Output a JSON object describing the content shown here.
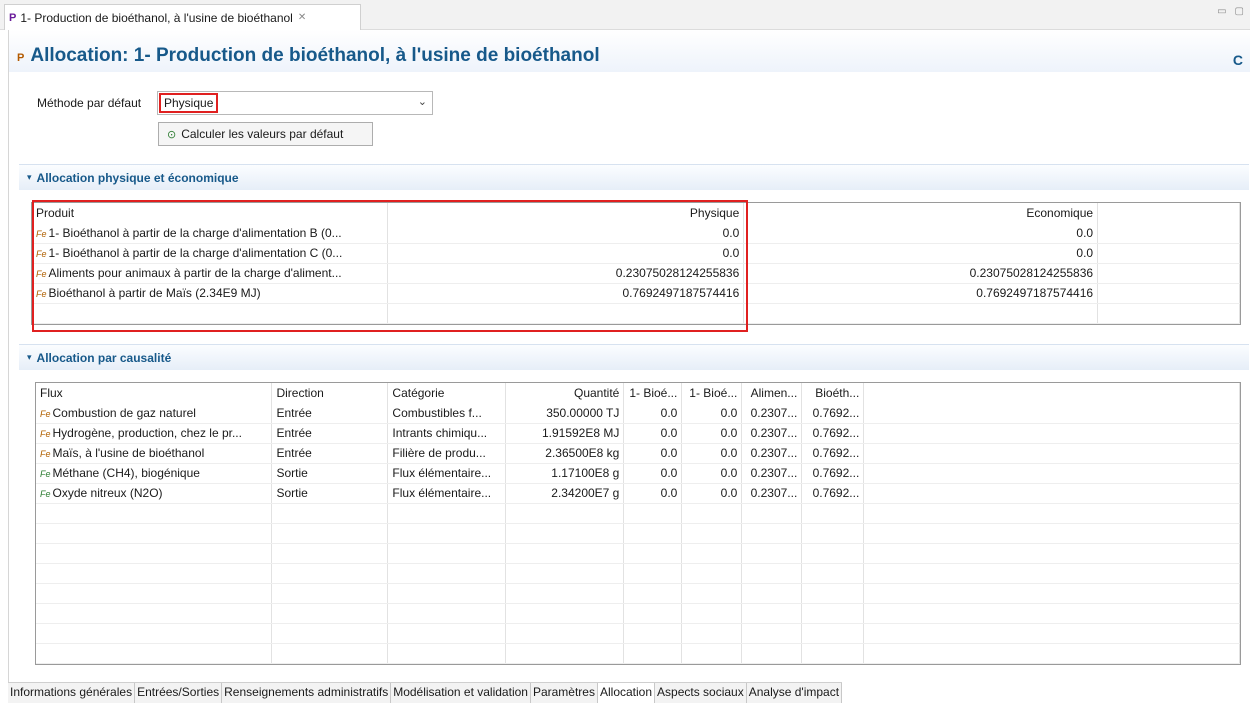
{
  "editor_tab": {
    "label": "1- Production de bioéthanol, à l'usine de bioéthanol",
    "icon": "process-icon"
  },
  "header": {
    "title": "Allocation: 1- Production de bioéthanol, à l'usine de bioéthanol",
    "refresh_icon": "refresh-icon"
  },
  "method": {
    "label": "Méthode par défaut",
    "value": "Physique"
  },
  "calc_button": {
    "label": "Calculer les valeurs par défaut"
  },
  "section_physical": {
    "title": "Allocation physique et économique",
    "columns": [
      "Produit",
      "Physique",
      "Economique"
    ],
    "rows": [
      [
        "1- Bioéthanol à partir de la charge d'alimentation B (0...",
        "0.0",
        "0.0"
      ],
      [
        "1- Bioéthanol à partir de la charge d'alimentation C (0...",
        "0.0",
        "0.0"
      ],
      [
        "Aliments pour animaux à partir de la charge d'aliment...",
        "0.23075028124255836",
        "0.23075028124255836"
      ],
      [
        "Bioéthanol à partir de Maïs (2.34E9 MJ)",
        "0.7692497187574416",
        "0.7692497187574416"
      ]
    ]
  },
  "section_causal": {
    "title": "Allocation par causalité",
    "columns": [
      "Flux",
      "Direction",
      "Catégorie",
      "Quantité",
      "1- Bioé...",
      "1- Bioé...",
      "Alimen...",
      "Bioéth..."
    ],
    "rows": [
      [
        "Combustion de gaz naturel",
        "Entrée",
        "Combustibles f...",
        "350.00000 TJ",
        "0.0",
        "0.0",
        "0.2307...",
        "0.7692..."
      ],
      [
        "Hydrogène, production, chez le pr...",
        "Entrée",
        "Intrants chimiqu...",
        "1.91592E8 MJ",
        "0.0",
        "0.0",
        "0.2307...",
        "0.7692..."
      ],
      [
        "Maïs, à l'usine de bioéthanol",
        "Entrée",
        "Filière de produ...",
        "2.36500E8 kg",
        "0.0",
        "0.0",
        "0.2307...",
        "0.7692..."
      ],
      [
        "Méthane (CH4), biogénique",
        "Sortie",
        "Flux élémentaire...",
        "1.17100E8 g",
        "0.0",
        "0.0",
        "0.2307...",
        "0.7692..."
      ],
      [
        "Oxyde nitreux (N2O)",
        "Sortie",
        "Flux élémentaire...",
        "2.34200E7 g",
        "0.0",
        "0.0",
        "0.2307...",
        "0.7692..."
      ]
    ],
    "row_icons": [
      "product-flow-icon",
      "product-flow-icon",
      "product-flow-icon",
      "elementary-flow-icon",
      "elementary-flow-icon"
    ]
  },
  "bottom_tabs": [
    "Informations générales",
    "Entrées/Sorties",
    "Renseignements administratifs",
    "Modélisation et validation",
    "Paramètres",
    "Allocation",
    "Aspects sociaux",
    "Analyse d'impact"
  ],
  "active_bottom_tab": "Allocation",
  "colors": {
    "accent": "#17598a",
    "highlight": "#e02020"
  }
}
